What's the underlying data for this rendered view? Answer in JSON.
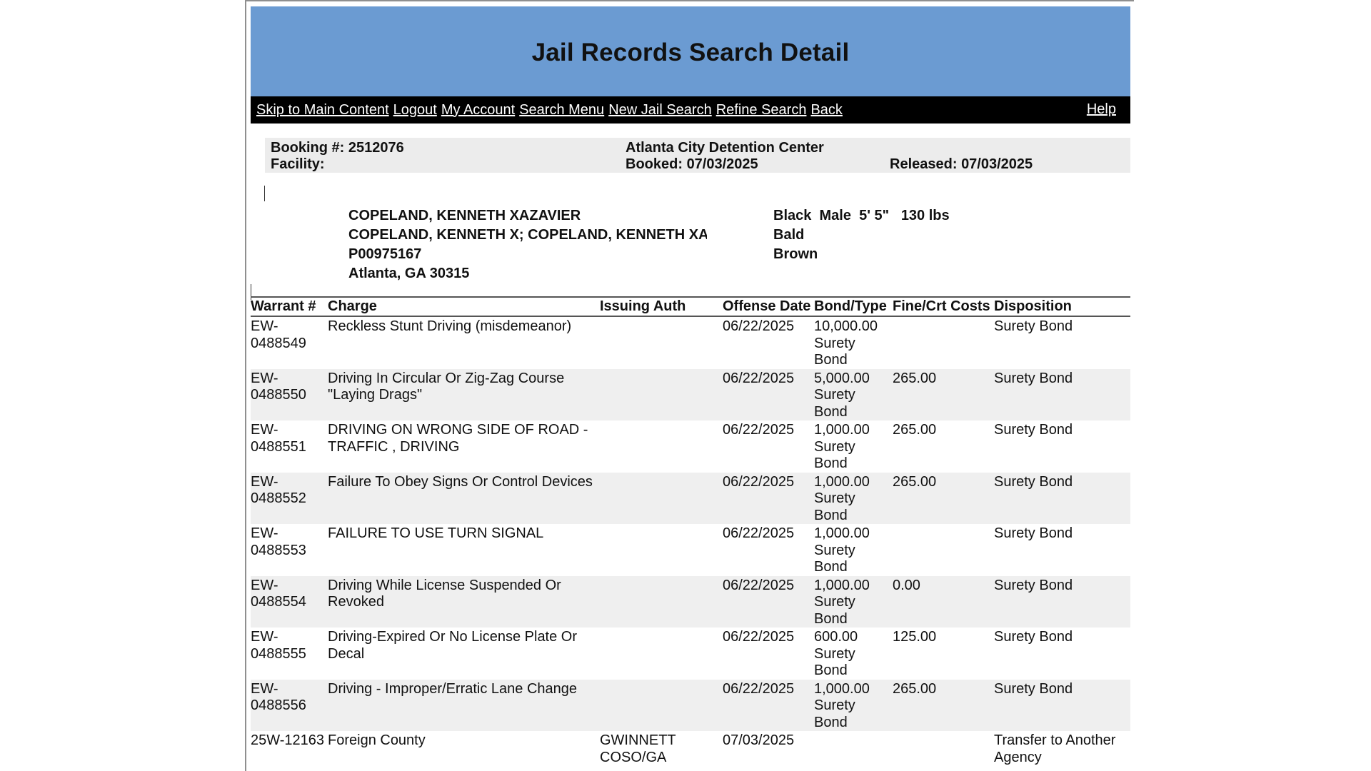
{
  "header": {
    "title": "Jail Records Search Detail"
  },
  "nav": {
    "links": [
      "Skip to Main Content",
      "Logout",
      "My Account",
      "Search Menu",
      "New Jail Search",
      "Refine Search",
      "Back"
    ],
    "help": "Help"
  },
  "booking": {
    "booking_label": "Booking #:",
    "booking_number": "2512076",
    "facility_label": "Facility:",
    "facility_name": "Atlanta City Detention Center",
    "booked_label": "Booked:",
    "booked_date": "07/03/2025",
    "released_label": "Released:",
    "released_date": "07/03/2025"
  },
  "person": {
    "name": "COPELAND, KENNETH XAZAVIER",
    "aliases": "COPELAND, KENNETH X; COPELAND, KENNETH XAZAVIER",
    "id": "P00975167",
    "location": "Atlanta, GA 30315",
    "race": "Black",
    "sex": "Male",
    "height": "5' 5\"",
    "weight": "130 lbs",
    "hair": "Bald",
    "eyes": "Brown"
  },
  "records": {
    "headers": [
      "Warrant #",
      "Charge",
      "Issuing Auth",
      "Offense Date",
      "Bond/Type",
      "Fine/Crt Costs",
      "Disposition"
    ],
    "rows": [
      {
        "warrant": "EW-0488549",
        "charge": "Reckless Stunt Driving (misdemeanor)",
        "issuing": "",
        "offense_date": "06/22/2025",
        "bond_amount": "10,000.00",
        "bond_type": "Surety Bond",
        "fine": "",
        "disposition": "Surety Bond"
      },
      {
        "warrant": "EW-0488550",
        "charge": "Driving In Circular Or Zig-Zag Course \"Laying Drags\"",
        "issuing": "",
        "offense_date": "06/22/2025",
        "bond_amount": "5,000.00",
        "bond_type": "Surety Bond",
        "fine": "265.00",
        "disposition": "Surety Bond"
      },
      {
        "warrant": "EW-0488551",
        "charge": "DRIVING ON WRONG SIDE OF ROAD - TRAFFIC , DRIVING",
        "issuing": "",
        "offense_date": "06/22/2025",
        "bond_amount": "1,000.00",
        "bond_type": "Surety Bond",
        "fine": "265.00",
        "disposition": "Surety Bond"
      },
      {
        "warrant": "EW-0488552",
        "charge": "Failure To Obey Signs Or Control Devices",
        "issuing": "",
        "offense_date": "06/22/2025",
        "bond_amount": "1,000.00",
        "bond_type": "Surety Bond",
        "fine": "265.00",
        "disposition": "Surety Bond"
      },
      {
        "warrant": "EW-0488553",
        "charge": "FAILURE TO USE TURN SIGNAL",
        "issuing": "",
        "offense_date": "06/22/2025",
        "bond_amount": "1,000.00",
        "bond_type": "Surety Bond",
        "fine": "",
        "disposition": "Surety Bond"
      },
      {
        "warrant": "EW-0488554",
        "charge": "Driving While License Suspended Or Revoked",
        "issuing": "",
        "offense_date": "06/22/2025",
        "bond_amount": "1,000.00",
        "bond_type": "Surety Bond",
        "fine": "0.00",
        "disposition": "Surety Bond"
      },
      {
        "warrant": "EW-0488555",
        "charge": "Driving-Expired Or No License Plate Or Decal",
        "issuing": "",
        "offense_date": "06/22/2025",
        "bond_amount": "600.00",
        "bond_type": "Surety Bond",
        "fine": "125.00",
        "disposition": "Surety Bond"
      },
      {
        "warrant": "EW-0488556",
        "charge": "Driving - Improper/Erratic Lane Change",
        "issuing": "",
        "offense_date": "06/22/2025",
        "bond_amount": "1,000.00",
        "bond_type": "Surety Bond",
        "fine": "265.00",
        "disposition": "Surety Bond"
      },
      {
        "warrant": "25W-12163",
        "charge": "Foreign County",
        "issuing": "GWINNETT COSO/GA",
        "offense_date": "07/03/2025",
        "bond_amount": "",
        "bond_type": "",
        "fine": "",
        "disposition": "Transfer to Another Agency"
      }
    ]
  }
}
